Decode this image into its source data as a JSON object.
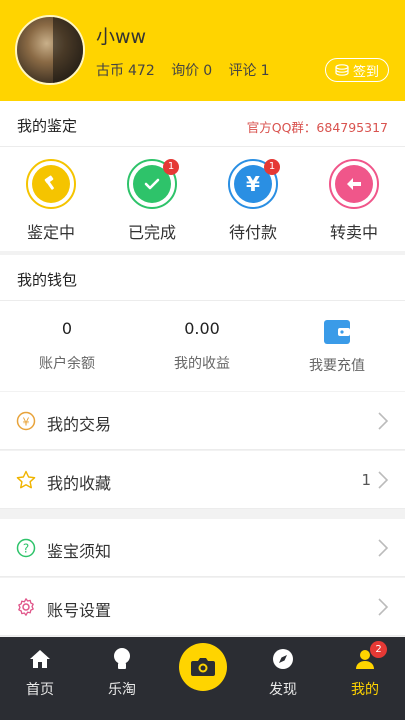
{
  "profile": {
    "username": "小ww",
    "coins_label": "古币",
    "coins": "472",
    "inquiry_label": "询价",
    "inquiry": "0",
    "comment_label": "评论",
    "comment": "1",
    "checkin_label": "签到"
  },
  "appraisal_section": {
    "title": "我的鉴定",
    "qq_text": "官方QQ群：684795317",
    "items": [
      {
        "label": "鉴定中",
        "icon": "gavel-icon",
        "color": "#f5c400",
        "badge": ""
      },
      {
        "label": "已完成",
        "icon": "check-icon",
        "color": "#2ec36a",
        "badge": "1"
      },
      {
        "label": "待付款",
        "icon": "yen-icon",
        "color": "#2a8fe3",
        "badge": "1"
      },
      {
        "label": "转卖中",
        "icon": "return-arrow-icon",
        "color": "#f0568a",
        "badge": ""
      }
    ]
  },
  "wallet_section": {
    "title": "我的钱包",
    "balance_value": "0",
    "balance_label": "账户余额",
    "earnings_value": "0.00",
    "earnings_label": "我的收益",
    "recharge_label": "我要充值"
  },
  "menu": [
    {
      "label": "我的交易",
      "icon": "yen-circle-icon",
      "count": ""
    },
    {
      "label": "我的收藏",
      "icon": "star-icon",
      "count": "1"
    },
    {
      "label": "鉴宝须知",
      "icon": "question-icon",
      "count": ""
    },
    {
      "label": "账号设置",
      "icon": "gear-icon",
      "count": ""
    }
  ],
  "tabbar": {
    "home": "首页",
    "lepan": "乐淘",
    "discover": "发现",
    "mine": "我的",
    "mine_badge": "2"
  },
  "colors": {
    "accent": "#ffd400",
    "tabbar_bg": "#2b2d33",
    "badge": "#e53935"
  }
}
